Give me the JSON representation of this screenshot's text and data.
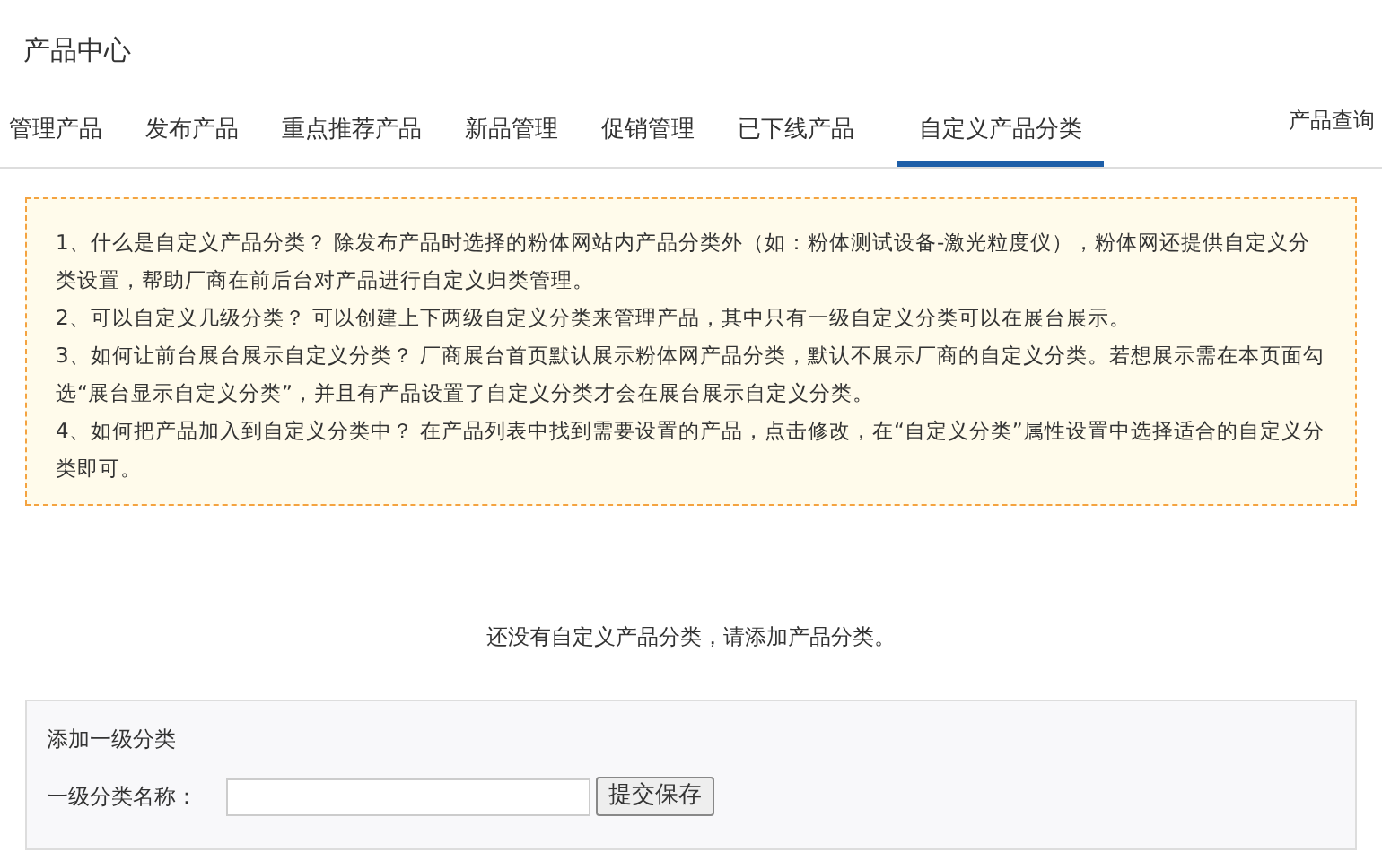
{
  "page_title": "产品中心",
  "tabs": [
    {
      "label": "管理产品",
      "selected": false
    },
    {
      "label": "发布产品",
      "selected": false
    },
    {
      "label": "重点推荐产品",
      "selected": false
    },
    {
      "label": "新品管理",
      "selected": false
    },
    {
      "label": "促销管理",
      "selected": false
    },
    {
      "label": "已下线产品",
      "selected": false
    },
    {
      "label": "自定义产品分类",
      "selected": true
    }
  ],
  "right_link": "产品查询",
  "notice": [
    "1、什么是自定义产品分类？ 除发布产品时选择的粉体网站内产品分类外（如：粉体测试设备-激光粒度仪），粉体网还提供自定义分类设置，帮助厂商在前后台对产品进行自定义归类管理。",
    "2、可以自定义几级分类？ 可以创建上下两级自定义分类来管理产品，其中只有一级自定义分类可以在展台展示。",
    "3、如何让前台展台展示自定义分类？ 厂商展台首页默认展示粉体网产品分类，默认不展示厂商的自定义分类。若想展示需在本页面勾选“展台显示自定义分类”，并且有产品设置了自定义分类才会在展台展示自定义分类。",
    "4、如何把产品加入到自定义分类中？ 在产品列表中找到需要设置的产品，点击修改，在“自定义分类”属性设置中选择适合的自定义分类即可。"
  ],
  "empty_message": "还没有自定义产品分类，请添加产品分类。",
  "form": {
    "title": "添加一级分类",
    "field_label": "一级分类名称：",
    "submit": "提交保存"
  }
}
